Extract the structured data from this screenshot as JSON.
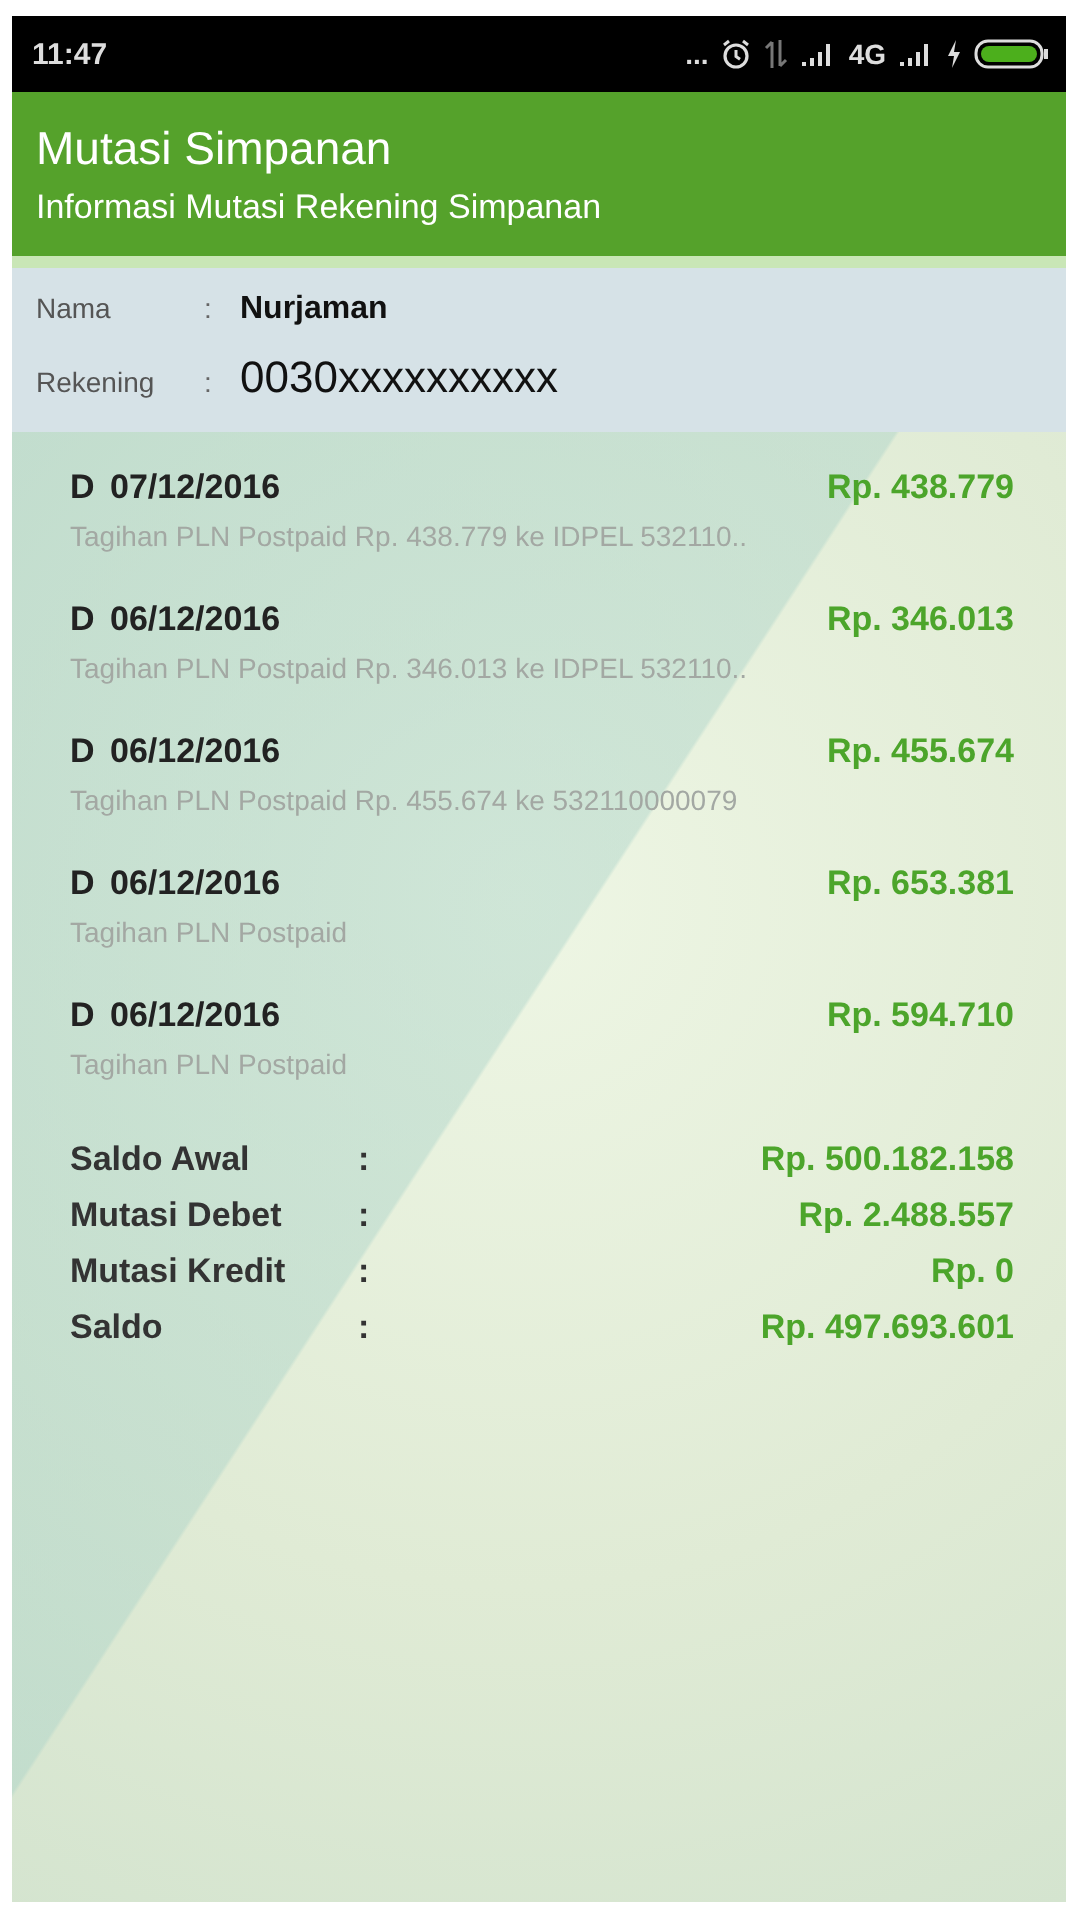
{
  "status_bar": {
    "time": "11:47",
    "more": "...",
    "network": "4G"
  },
  "header": {
    "title": "Mutasi Simpanan",
    "subtitle": "Informasi Mutasi Rekening Simpanan"
  },
  "account": [
    {
      "label": "Nama",
      "separator": ":",
      "value": "Nurjaman",
      "kind": "name"
    },
    {
      "label": "Rekening",
      "separator": ":",
      "value": "0030xxxxxxxxxx",
      "kind": "number"
    }
  ],
  "transactions": [
    {
      "type": "D",
      "date": "07/12/2016",
      "amount": "Rp. 438.779",
      "description": "Tagihan PLN Postpaid Rp. 438.779 ke IDPEL 532110.."
    },
    {
      "type": "D",
      "date": "06/12/2016",
      "amount": "Rp. 346.013",
      "description": "Tagihan PLN Postpaid Rp. 346.013 ke IDPEL 532110.."
    },
    {
      "type": "D",
      "date": "06/12/2016",
      "amount": "Rp. 455.674",
      "description": "Tagihan PLN Postpaid Rp. 455.674 ke 532110000079"
    },
    {
      "type": "D",
      "date": "06/12/2016",
      "amount": "Rp. 653.381",
      "description": "Tagihan PLN Postpaid"
    },
    {
      "type": "D",
      "date": "06/12/2016",
      "amount": "Rp. 594.710",
      "description": "Tagihan PLN Postpaid"
    }
  ],
  "summary": [
    {
      "label": "Saldo Awal",
      "separator": ":",
      "value": "Rp. 500.182.158"
    },
    {
      "label": "Mutasi Debet",
      "separator": ":",
      "value": "Rp. 2.488.557"
    },
    {
      "label": "Mutasi Kredit",
      "separator": ":",
      "value": "Rp. 0"
    },
    {
      "label": "Saldo",
      "separator": ":",
      "value": "Rp. 497.693.601"
    }
  ]
}
